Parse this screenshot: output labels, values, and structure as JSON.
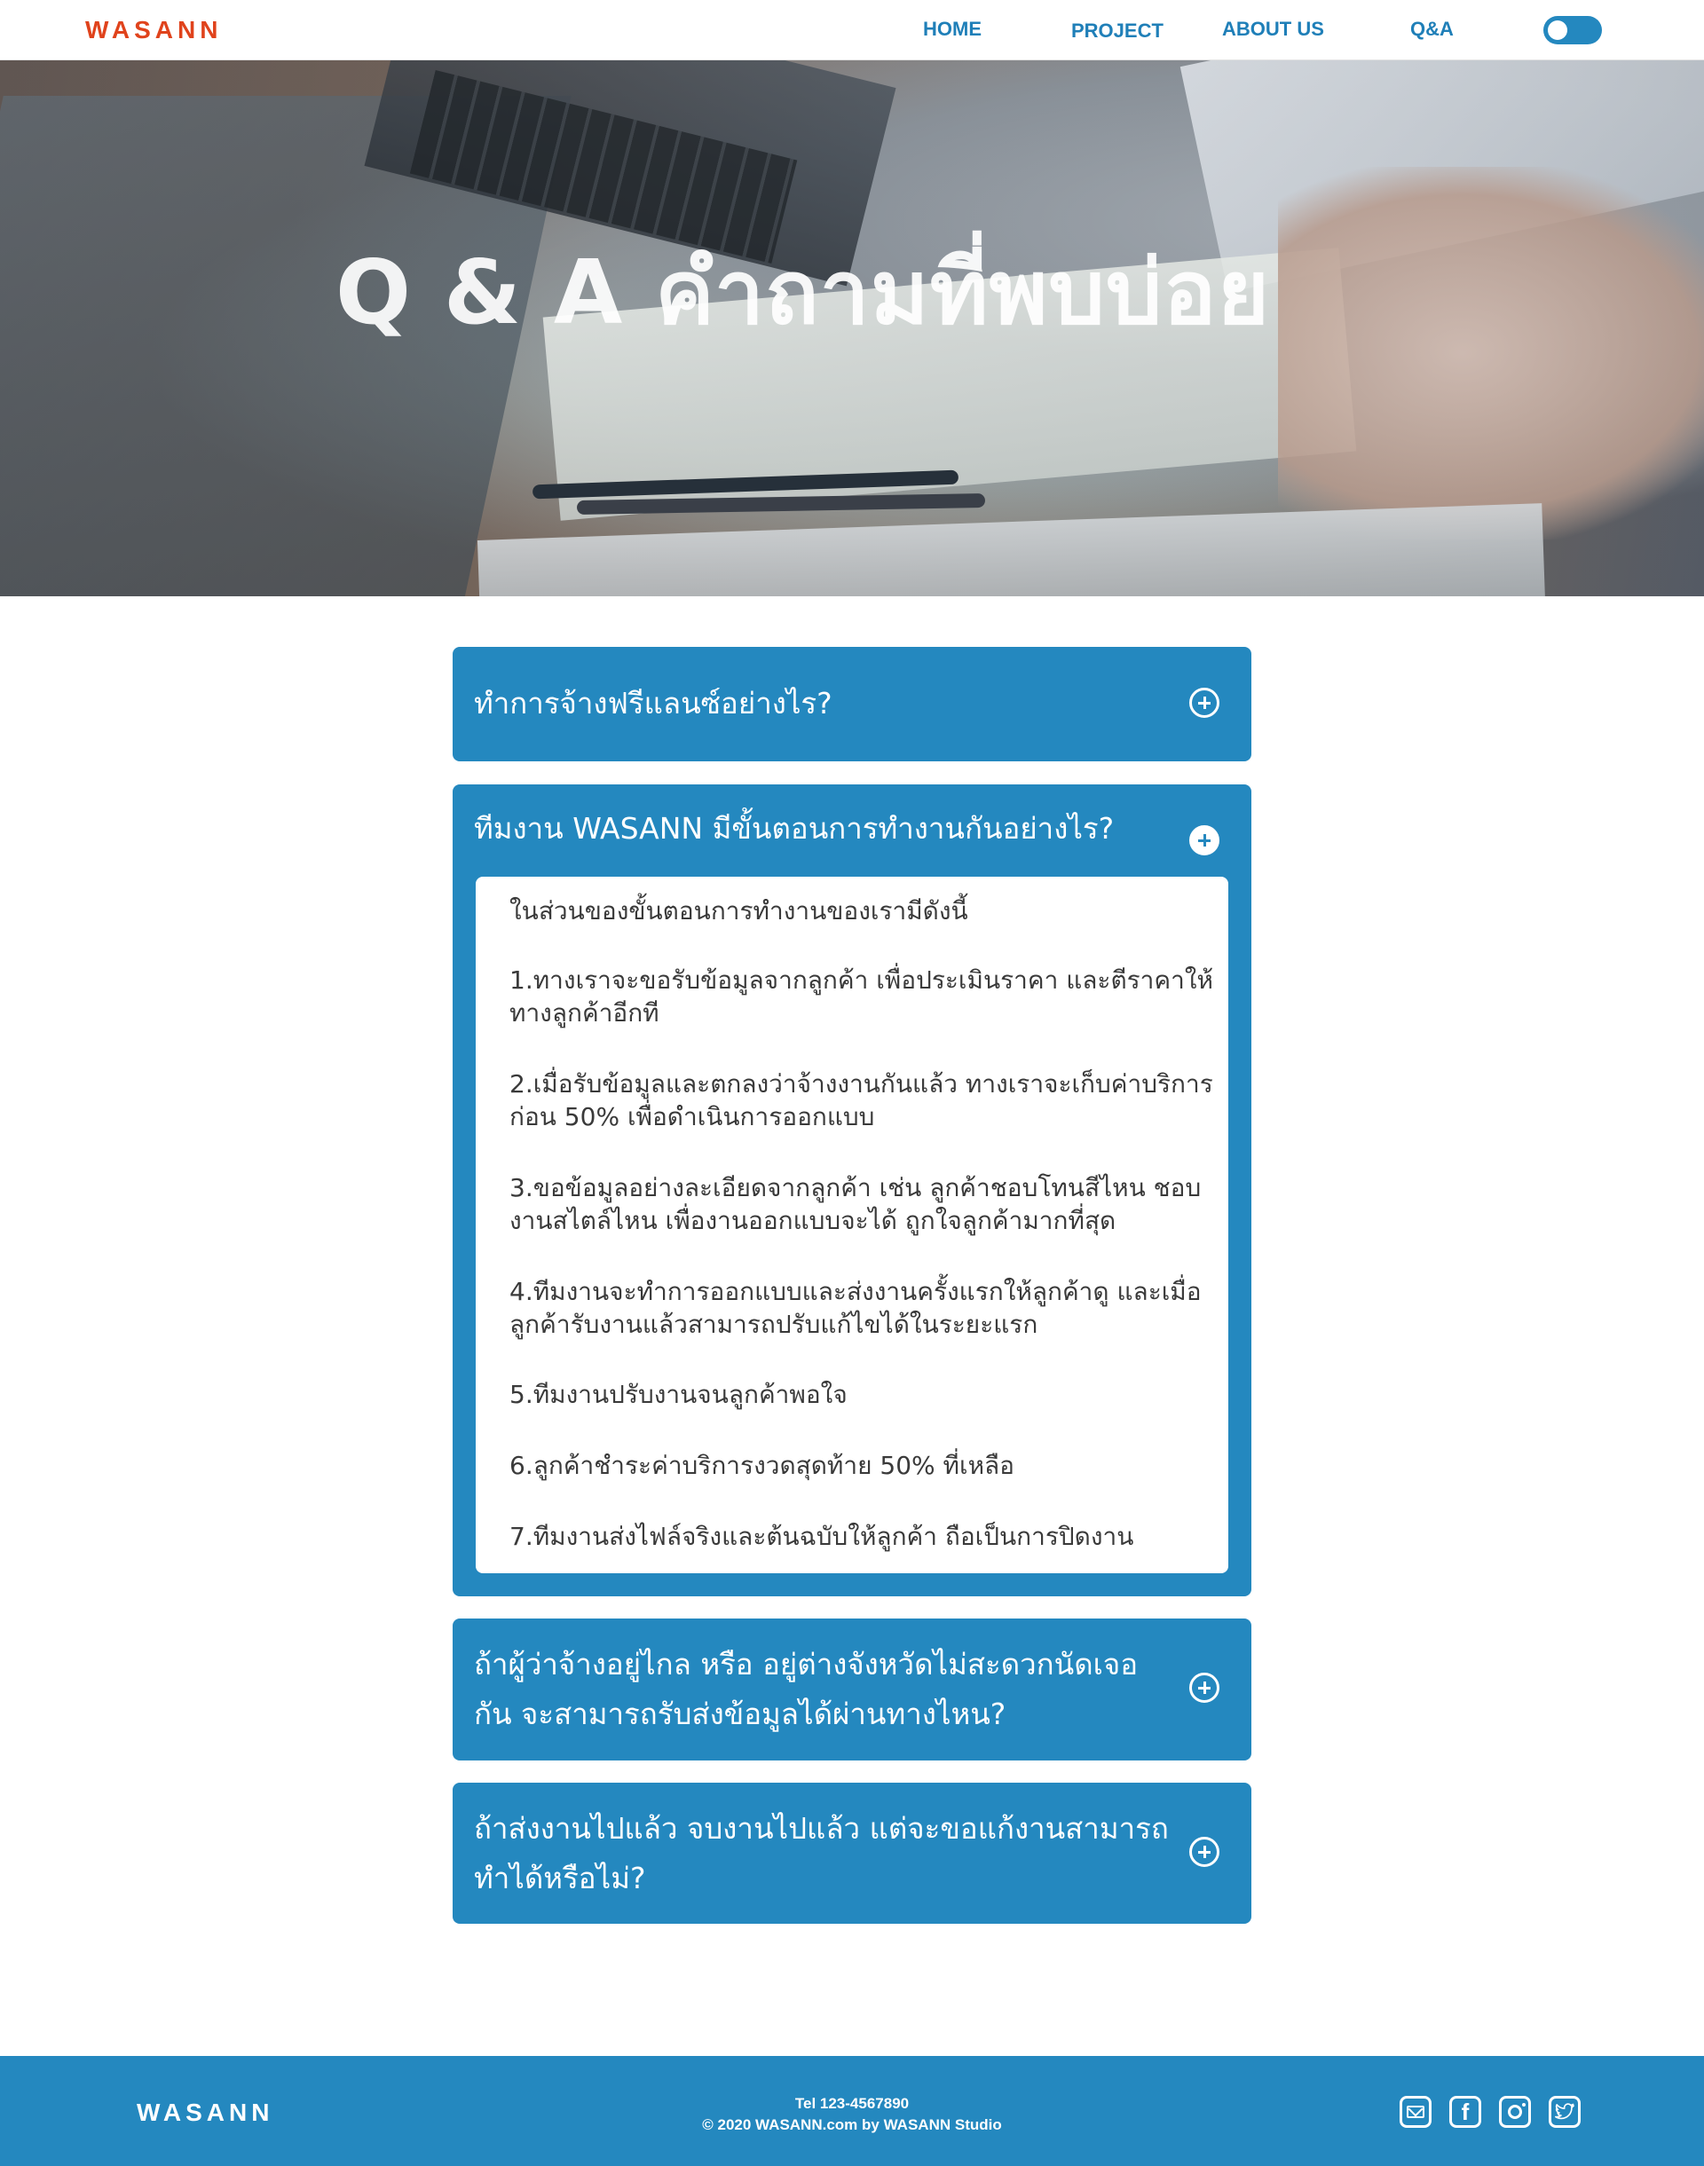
{
  "brand": {
    "logo": "WASANN",
    "accent": "#e0431c",
    "primary": "#2488bf"
  },
  "nav": {
    "home": "HOME",
    "project": "PROJECT",
    "about": "ABOUT US",
    "qa": "Q&A"
  },
  "hero": {
    "title": "Q & A คำถามที่พบบ่อย"
  },
  "faq": [
    {
      "question": "ทำการจ้างฟรีแลนซ์อย่างไร?",
      "expanded": false
    },
    {
      "question": "ทีมงาน WASANN มีขั้นตอนการทำงานกันอย่างไร?",
      "expanded": true,
      "answer": [
        "ในส่วนของขั้นตอนการทำงานของเรามีดังนี้",
        "1.ทางเราจะขอรับข้อมูลจากลูกค้า เพื่อประเมินราคา และตีราคาให้ทางลูกค้าอีกที",
        "2.เมื่อรับข้อมูลและตกลงว่าจ้างงานกันแล้ว ทางเราจะเก็บค่าบริการก่อน 50% เพื่อดำเนินการออกแบบ",
        "3.ขอข้อมูลอย่างละเอียดจากลูกค้า เช่น ลูกค้าชอบโทนสีไหน ชอบงานสไตล์ไหน เพื่องานออกแบบจะได้ ถูกใจลูกค้ามากที่สุด",
        "4.ทีมงานจะทำการออกแบบและส่งงานครั้งแรกให้ลูกค้าดู และเมื่อลูกค้ารับงานแล้วสามารถปรับแก้ไขได้ในระยะแรก",
        "5.ทีมงานปรับงานจนลูกค้าพอใจ",
        "6.ลูกค้าชำระค่าบริการงวดสุดท้าย 50% ที่เหลือ",
        "7.ทีมงานส่งไฟล์จริงและต้นฉบับให้ลูกค้า ถือเป็นการปิดงาน"
      ]
    },
    {
      "question": "ถ้าผู้ว่าจ้างอยู่ไกล หรือ อยู่ต่างจังหวัดไม่สะดวกนัดเจอกัน จะสามารถรับส่งข้อมูลได้ผ่านทางไหน?",
      "expanded": false
    },
    {
      "question": "ถ้าส่งงานไปแล้ว จบงานไปแล้ว แต่จะขอแก้งานสามารถทำได้หรือไม่?",
      "expanded": false
    }
  ],
  "footer": {
    "logo": "WASANN",
    "tel": "Tel 123-4567890",
    "copyright": "© 2020 WASANN.com by WASANN Studio",
    "social_icons": [
      "mail-icon",
      "facebook-icon",
      "instagram-icon",
      "twitter-icon"
    ],
    "facebook_glyph": "f"
  }
}
